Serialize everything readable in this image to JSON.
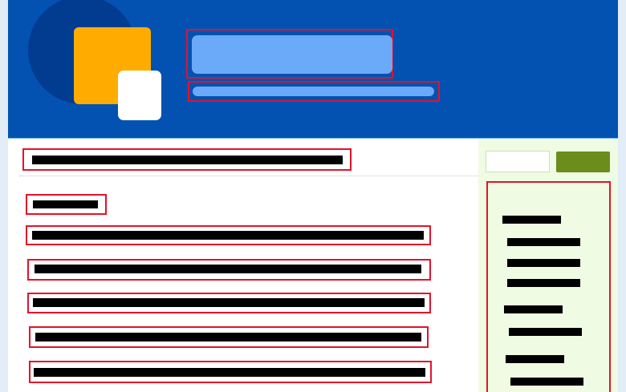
{
  "colors": {
    "header_bg": "#0352b1",
    "logo_circle": "#023c91",
    "logo_orange": "#ffab00",
    "redacted_block": "#6aaaf8",
    "annotation_outline": "#e3122a",
    "sidebar_bg": "#f0fbe3",
    "search_button": "#6a8d1c"
  },
  "header": {
    "site_title": "",
    "tagline": ""
  },
  "main": {
    "post_title": "",
    "section_heading": "",
    "list_items": [
      "",
      "",
      "",
      "",
      ""
    ]
  },
  "sidebar": {
    "search": {
      "placeholder": "",
      "button_label": ""
    },
    "widget_lines": [
      "",
      "",
      "",
      "",
      "",
      "",
      "",
      ""
    ]
  }
}
